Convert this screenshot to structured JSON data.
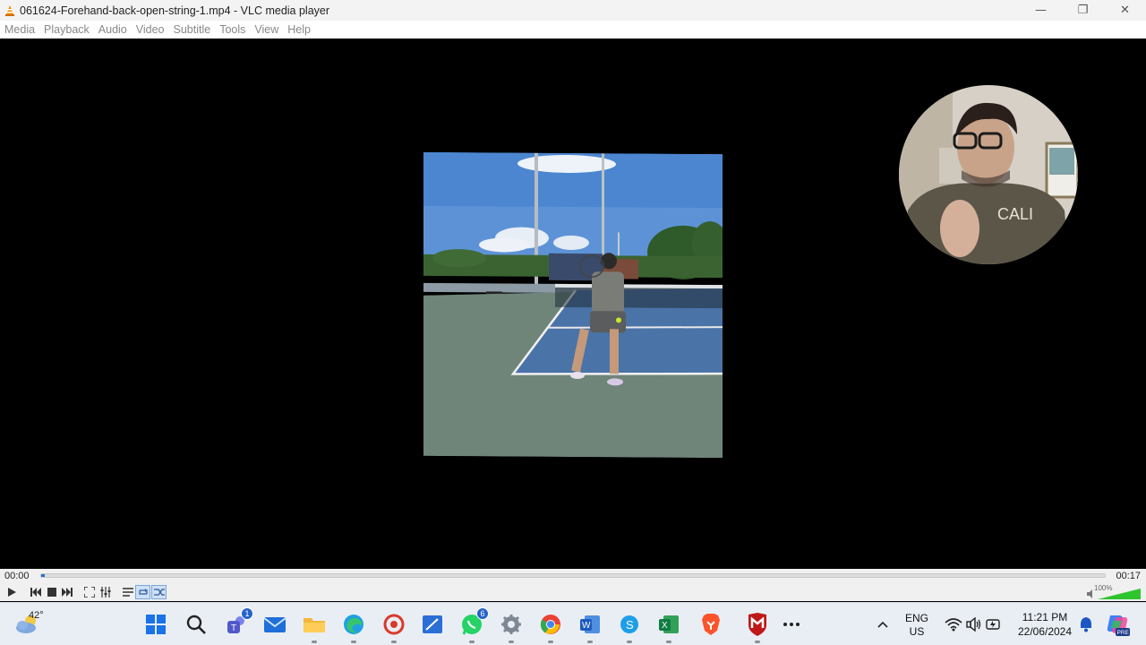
{
  "window": {
    "title": "061624-Forehand-back-open-string-1.mp4 - VLC media player",
    "minimize_glyph": "—",
    "maximize_glyph": "❐",
    "close_glyph": "✕"
  },
  "menu": {
    "items": [
      "Media",
      "Playback",
      "Audio",
      "Video",
      "Subtitle",
      "Tools",
      "View",
      "Help"
    ]
  },
  "playback": {
    "elapsed": "00:00",
    "total": "00:17",
    "progress": 0.002,
    "volume_label": "100%",
    "volume_level": 1.0
  },
  "taskbar": {
    "weather_temp": "42°",
    "teams_badge": "1",
    "whatsapp_badge": "6",
    "language_line1": "ENG",
    "language_line2": "US",
    "time": "11:21 PM",
    "date": "22/06/2024",
    "copilot_label": "PRE"
  },
  "colors": {
    "accent": "#2a6fd1",
    "vlc_orange": "#f08a00",
    "court_blue": "#4a73a8",
    "court_green": "#6f857a"
  }
}
